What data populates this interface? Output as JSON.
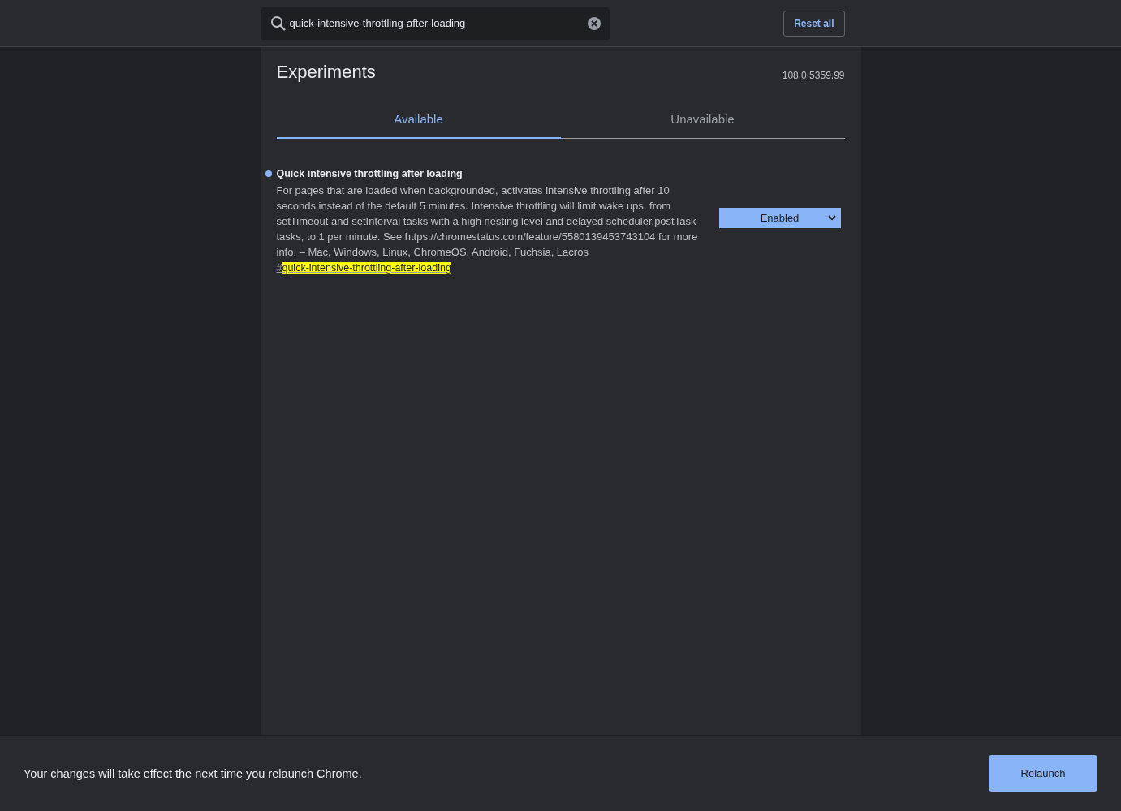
{
  "search": {
    "value": "quick-intensive-throttling-after-loading"
  },
  "reset_button": "Reset all",
  "title": "Experiments",
  "version": "108.0.5359.99",
  "tabs": [
    {
      "label": "Available",
      "selected": true
    },
    {
      "label": "Unavailable",
      "selected": false
    }
  ],
  "experiments": [
    {
      "name": "Quick intensive throttling after loading",
      "modified": true,
      "description": "For pages that are loaded when backgrounded, activates intensive throttling after 10 seconds instead of the default 5 minutes. Intensive throttling will limit wake ups, from setTimeout and setInterval tasks with a high nesting level and delayed scheduler.postTask tasks, to 1 per minute. See https://chromestatus.com/feature/5580139453743104 for more info. – Mac, Windows, Linux, ChromeOS, Android, Fuchsia, Lacros",
      "permalink_prefix": "#",
      "permalink_match": "quick-intensive-throttling-after-loading",
      "selection": "Enabled"
    }
  ],
  "footer": {
    "message": "Your changes will take effect the next time you relaunch Chrome.",
    "button": "Relaunch"
  }
}
